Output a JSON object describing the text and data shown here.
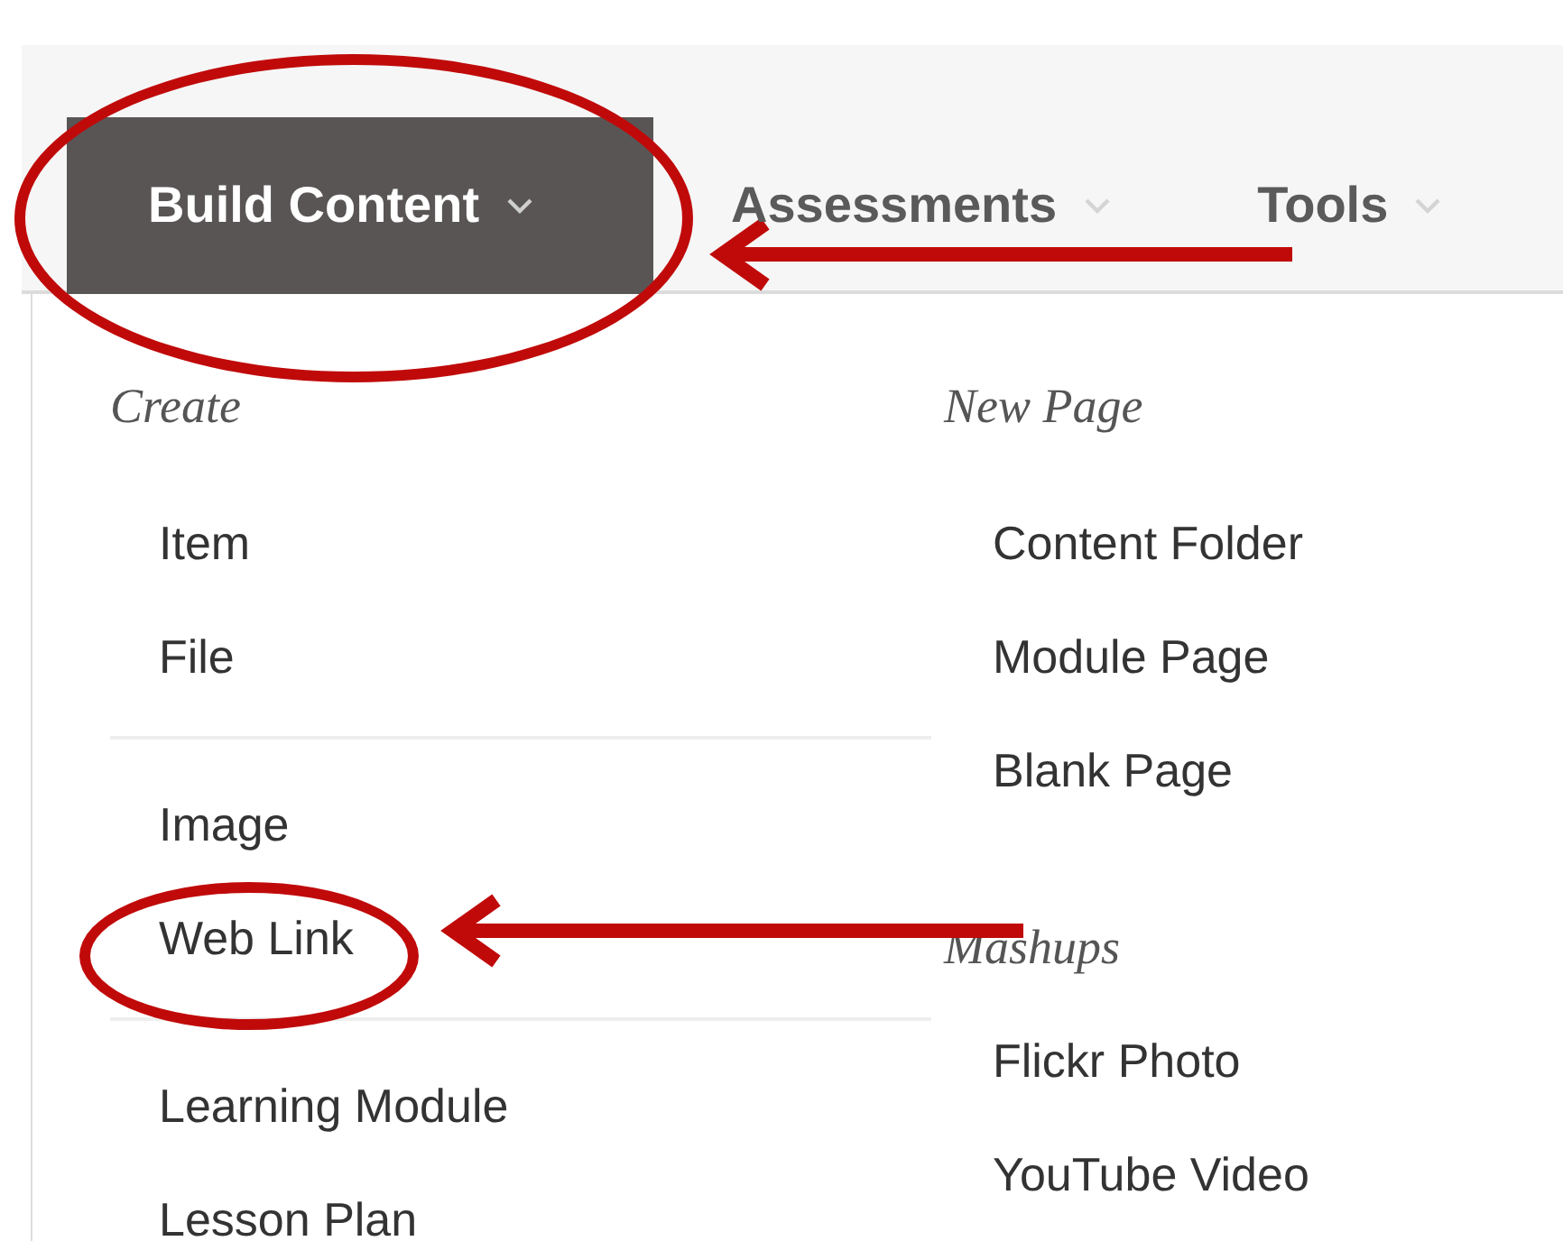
{
  "tabs": [
    {
      "label": "Build Content",
      "selected": true,
      "circled": true
    },
    {
      "label": "Assessments",
      "selected": false,
      "circled": false
    },
    {
      "label": "Tools",
      "selected": false,
      "circled": false
    }
  ],
  "menu": {
    "columns": [
      {
        "sections": [
          {
            "heading": "Create",
            "groups": [
              [
                {
                  "label": "Item",
                  "circled": false
                },
                {
                  "label": "File",
                  "circled": false
                }
              ],
              [
                {
                  "label": "Image",
                  "circled": false
                },
                {
                  "label": "Web Link",
                  "circled": true
                }
              ],
              [
                {
                  "label": "Learning Module",
                  "circled": false
                },
                {
                  "label": "Lesson Plan",
                  "circled": false
                }
              ]
            ]
          }
        ]
      },
      {
        "sections": [
          {
            "heading": "New Page",
            "groups": [
              [
                {
                  "label": "Content Folder",
                  "circled": false
                },
                {
                  "label": "Module Page",
                  "circled": false
                },
                {
                  "label": "Blank Page",
                  "circled": false
                }
              ]
            ]
          },
          {
            "heading": "Mashups",
            "groups": [
              [
                {
                  "label": "Flickr Photo",
                  "circled": false
                },
                {
                  "label": "YouTube Video",
                  "circled": false
                }
              ]
            ]
          }
        ]
      }
    ]
  }
}
